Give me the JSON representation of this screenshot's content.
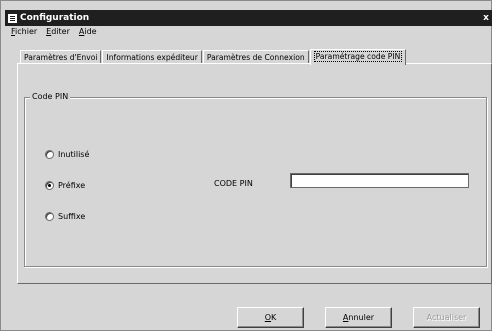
{
  "window": {
    "title": "Configuration",
    "close_glyph": "x"
  },
  "menu": {
    "items": [
      {
        "key": "F",
        "rest": "ichier"
      },
      {
        "key": "E",
        "rest": "diter"
      },
      {
        "key": "A",
        "rest": "ide"
      }
    ]
  },
  "tabs": [
    {
      "label": "Paramètres d'Envoi"
    },
    {
      "label": "Informations expéditeur"
    },
    {
      "label": "Paramètres de Connexion"
    },
    {
      "label": "Paramétrage code PIN",
      "active": true
    }
  ],
  "pin_group": {
    "legend": "Code PIN",
    "options": [
      {
        "label": "Inutilisé",
        "checked": false
      },
      {
        "label": "Préfixe",
        "checked": true
      },
      {
        "label": "Suffixe",
        "checked": false
      }
    ],
    "code_label": "CODE PIN",
    "code_value": ""
  },
  "buttons": {
    "ok": {
      "key": "O",
      "rest": "K"
    },
    "cancel": {
      "key": "A",
      "rest": "nnuler"
    },
    "refresh": {
      "key": "",
      "rest": "Actualiser",
      "disabled": true
    }
  }
}
